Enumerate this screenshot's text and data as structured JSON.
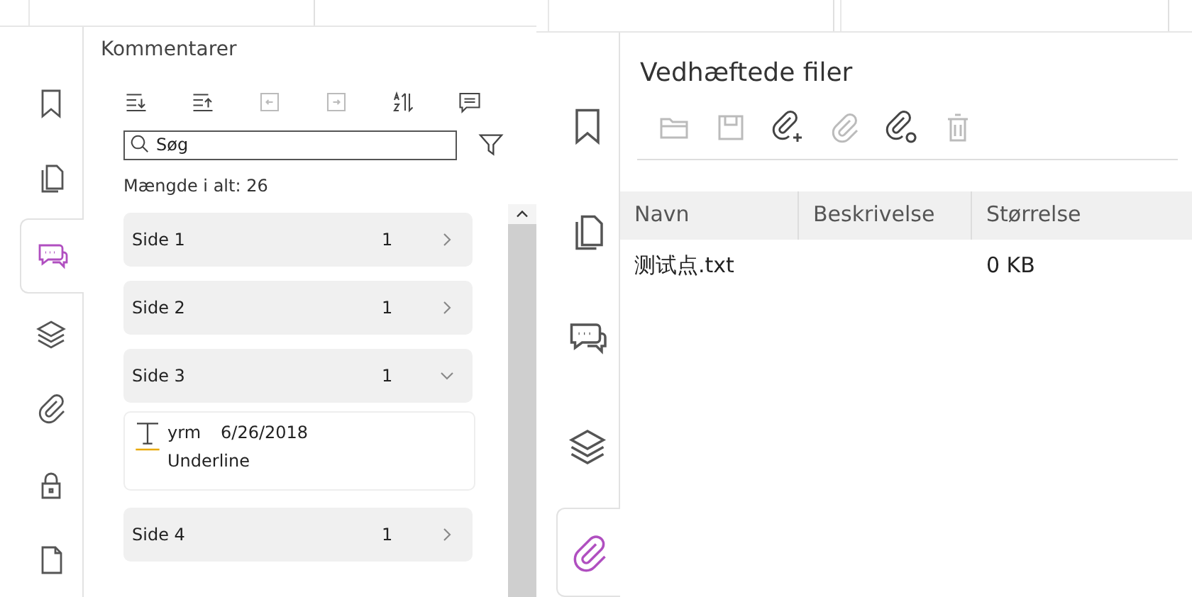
{
  "comments_panel": {
    "rail": [
      {
        "kind": "bookmark",
        "selected": false
      },
      {
        "kind": "pages",
        "selected": false
      },
      {
        "kind": "comments",
        "selected": true
      },
      {
        "kind": "layers",
        "selected": false
      },
      {
        "kind": "attachment",
        "selected": false
      },
      {
        "kind": "lock",
        "selected": false
      },
      {
        "kind": "page",
        "selected": false
      }
    ],
    "title": "Kommentarer",
    "toolbar": [
      {
        "kind": "expand-all",
        "disabled": false
      },
      {
        "kind": "collapse-all",
        "disabled": false
      },
      {
        "kind": "previous",
        "disabled": true
      },
      {
        "kind": "next",
        "disabled": true
      },
      {
        "kind": "sort",
        "disabled": false
      },
      {
        "kind": "note",
        "disabled": false
      }
    ],
    "search": {
      "placeholder": "Søg"
    },
    "total": "Mængde i alt: 26",
    "pages": [
      {
        "label": "Side 1",
        "count": "1",
        "expanded": false
      },
      {
        "label": "Side 2",
        "count": "1",
        "expanded": false
      },
      {
        "label": "Side 3",
        "count": "1",
        "expanded": true,
        "comments": [
          {
            "author": "yrm",
            "date": "6/26/2018",
            "type": "Underline"
          }
        ]
      },
      {
        "label": "Side 4",
        "count": "1",
        "expanded": false
      }
    ]
  },
  "attachments_panel": {
    "rail": [
      {
        "kind": "bookmark",
        "selected": false
      },
      {
        "kind": "pages",
        "selected": false
      },
      {
        "kind": "comments",
        "selected": false
      },
      {
        "kind": "layers",
        "selected": false
      },
      {
        "kind": "attachment",
        "selected": true
      }
    ],
    "title": "Vedhæftede filer",
    "toolbar": [
      {
        "kind": "folder",
        "disabled": true
      },
      {
        "kind": "save",
        "disabled": true
      },
      {
        "kind": "attach-add",
        "disabled": false
      },
      {
        "kind": "attachment",
        "disabled": true
      },
      {
        "kind": "attach-settings",
        "disabled": false
      },
      {
        "kind": "trash",
        "disabled": true
      }
    ],
    "columns": [
      "Navn",
      "Beskrivelse",
      "Størrelse"
    ],
    "rows": [
      [
        "测试点.txt",
        "",
        "0 KB"
      ]
    ]
  }
}
